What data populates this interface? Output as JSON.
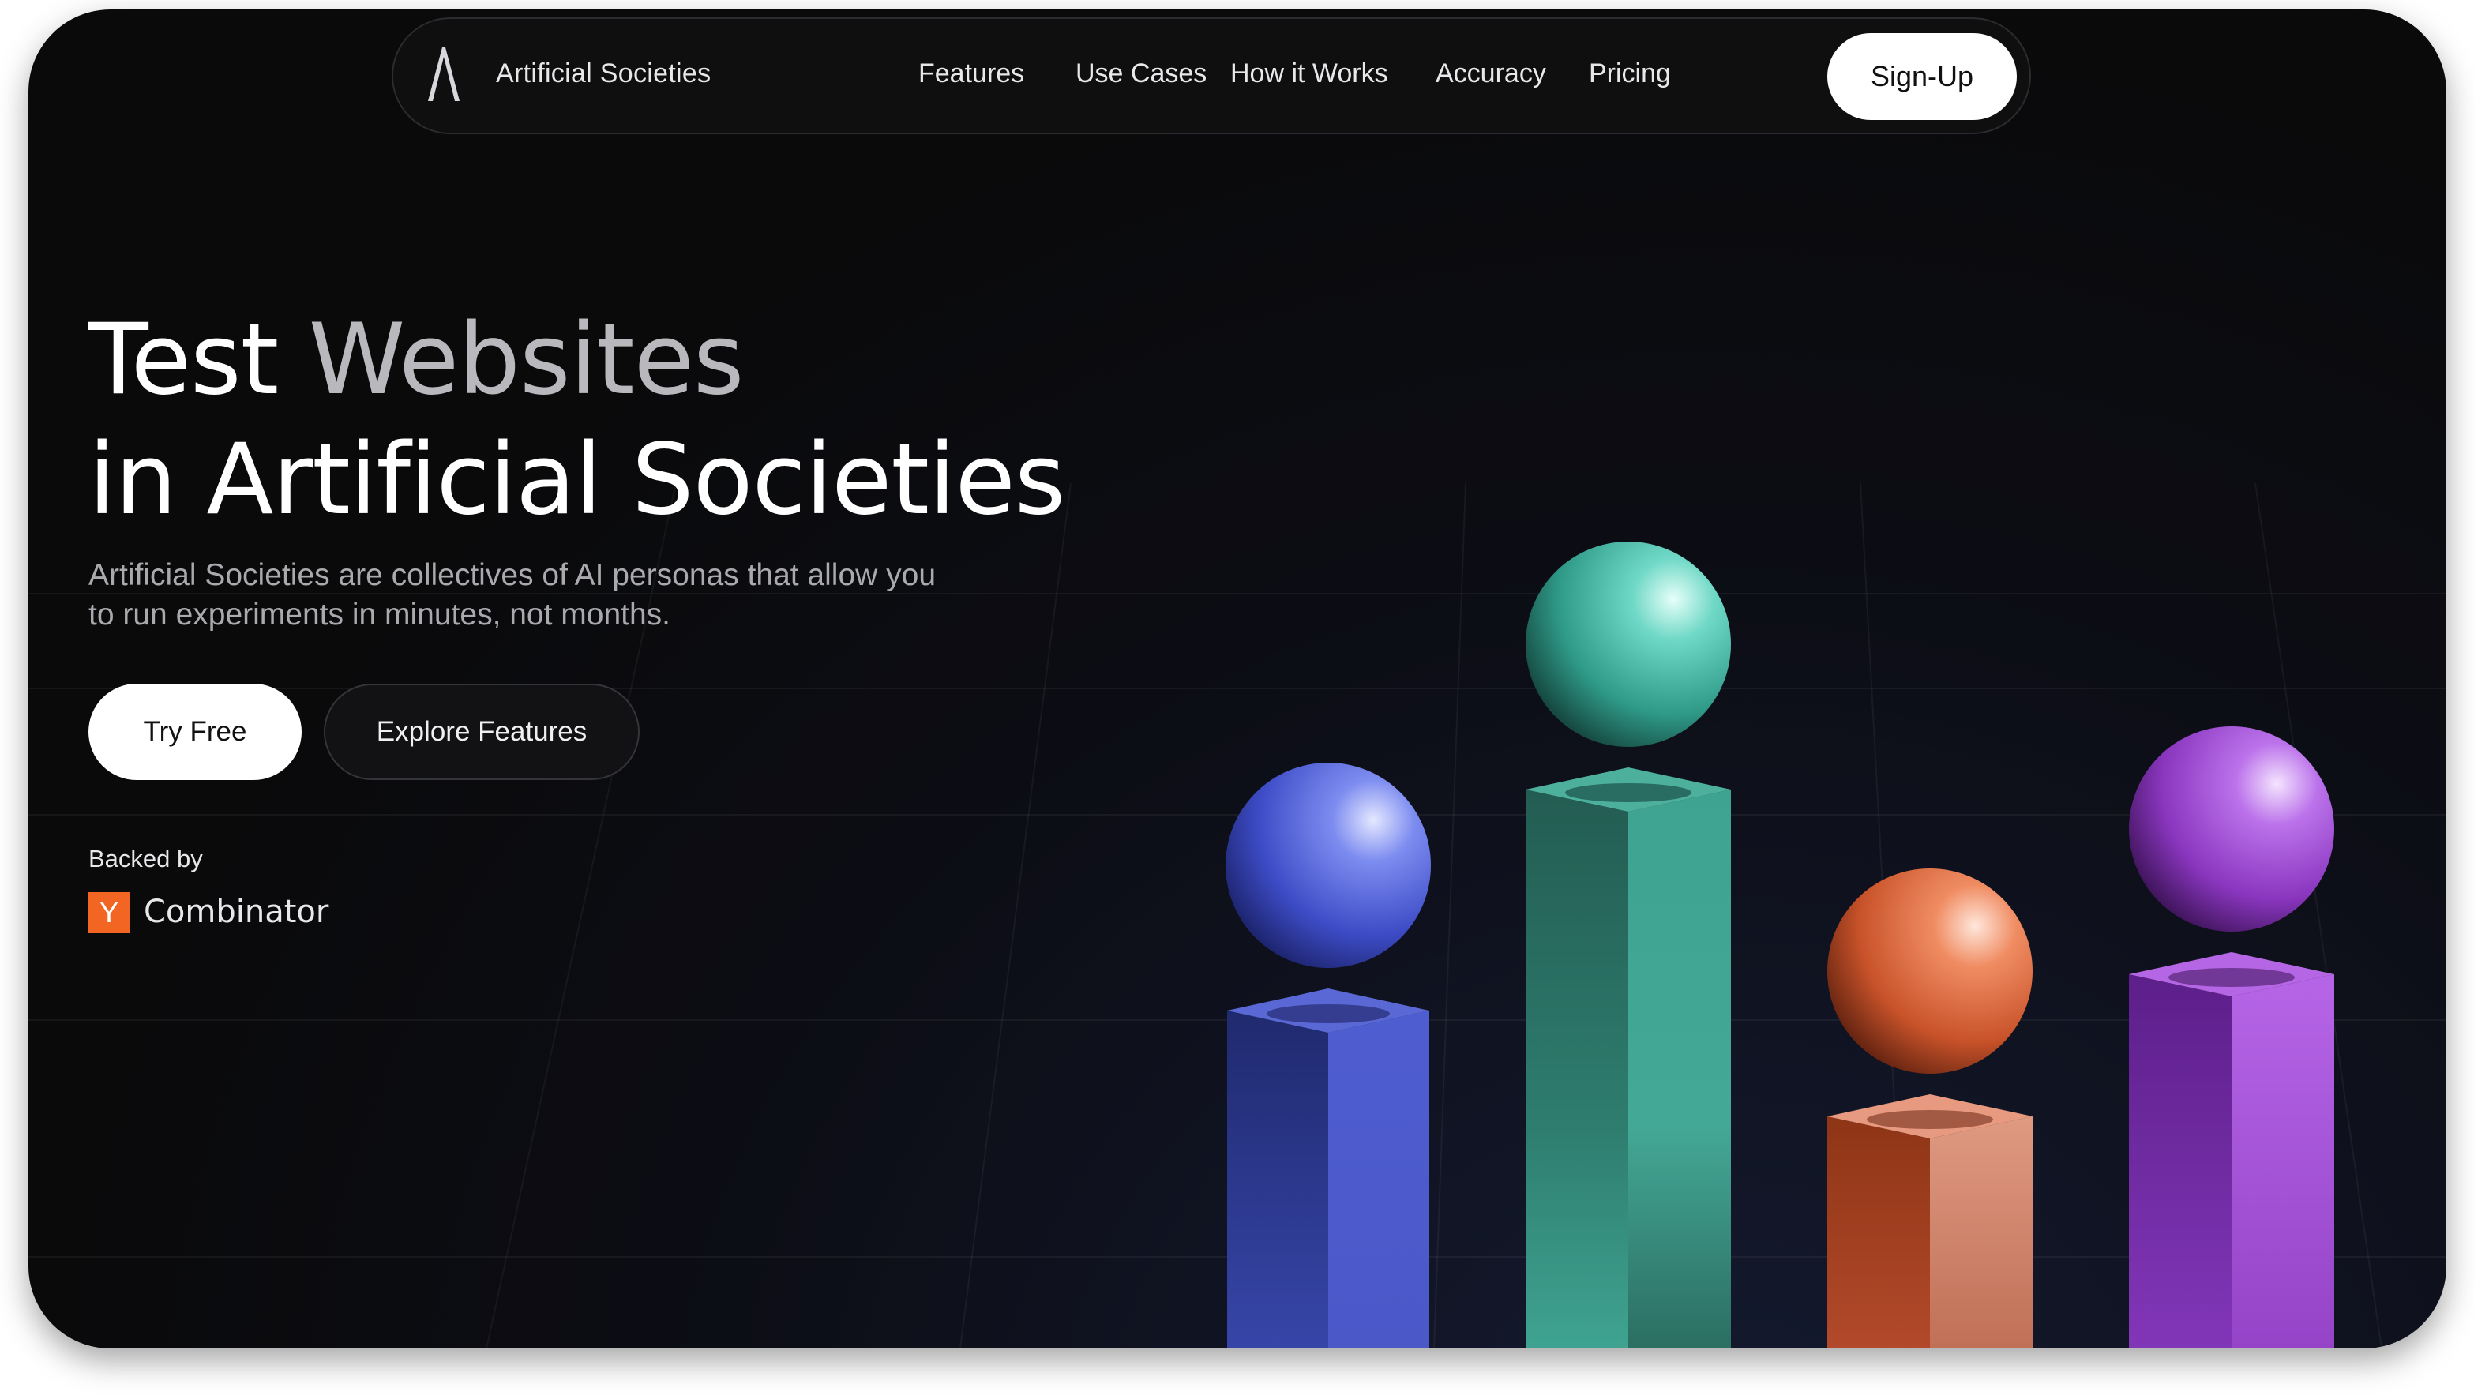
{
  "nav": {
    "brand": "Artificial Societies",
    "links": [
      "Features",
      "Use Cases",
      "How it Works",
      "Accuracy",
      "Pricing"
    ],
    "signup_label": "Sign-Up"
  },
  "hero": {
    "title_line1_a": "Test ",
    "title_line1_b": "Websites",
    "title_line2": "in Artificial Societies",
    "subtitle": "Artificial Societies are collectives of AI personas that allow you to run experiments in minutes, not months.",
    "try_label": "Try Free",
    "explore_label": "Explore Features"
  },
  "backed": {
    "label": "Backed by",
    "logo_letter": "Y",
    "name": "Combinator",
    "logo_color": "#f26522"
  },
  "illustration": {
    "colors": [
      "#4a5bd6",
      "#3aa896",
      "#d2653a",
      "#9b44c9"
    ]
  }
}
